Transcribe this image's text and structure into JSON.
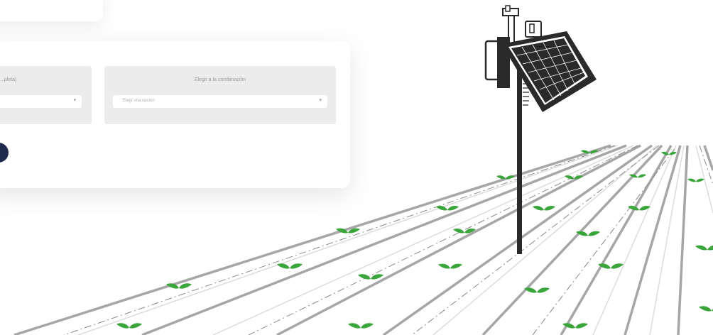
{
  "panels": {
    "left": {
      "label": "...pleta)",
      "select_value": ""
    },
    "right": {
      "label": "Elegir a la combinación",
      "select_value": "Elegí una opción"
    }
  },
  "icons": {
    "dropdown": "chevron-down-icon",
    "station": "weather-station-icon",
    "solar": "solar-panel-icon",
    "sprout": "sprout-icon"
  },
  "colors": {
    "accent": "#1f2a4d",
    "sprout": "#3aa53a",
    "line": "#a6a6a6",
    "panel_bg": "#ececec"
  }
}
